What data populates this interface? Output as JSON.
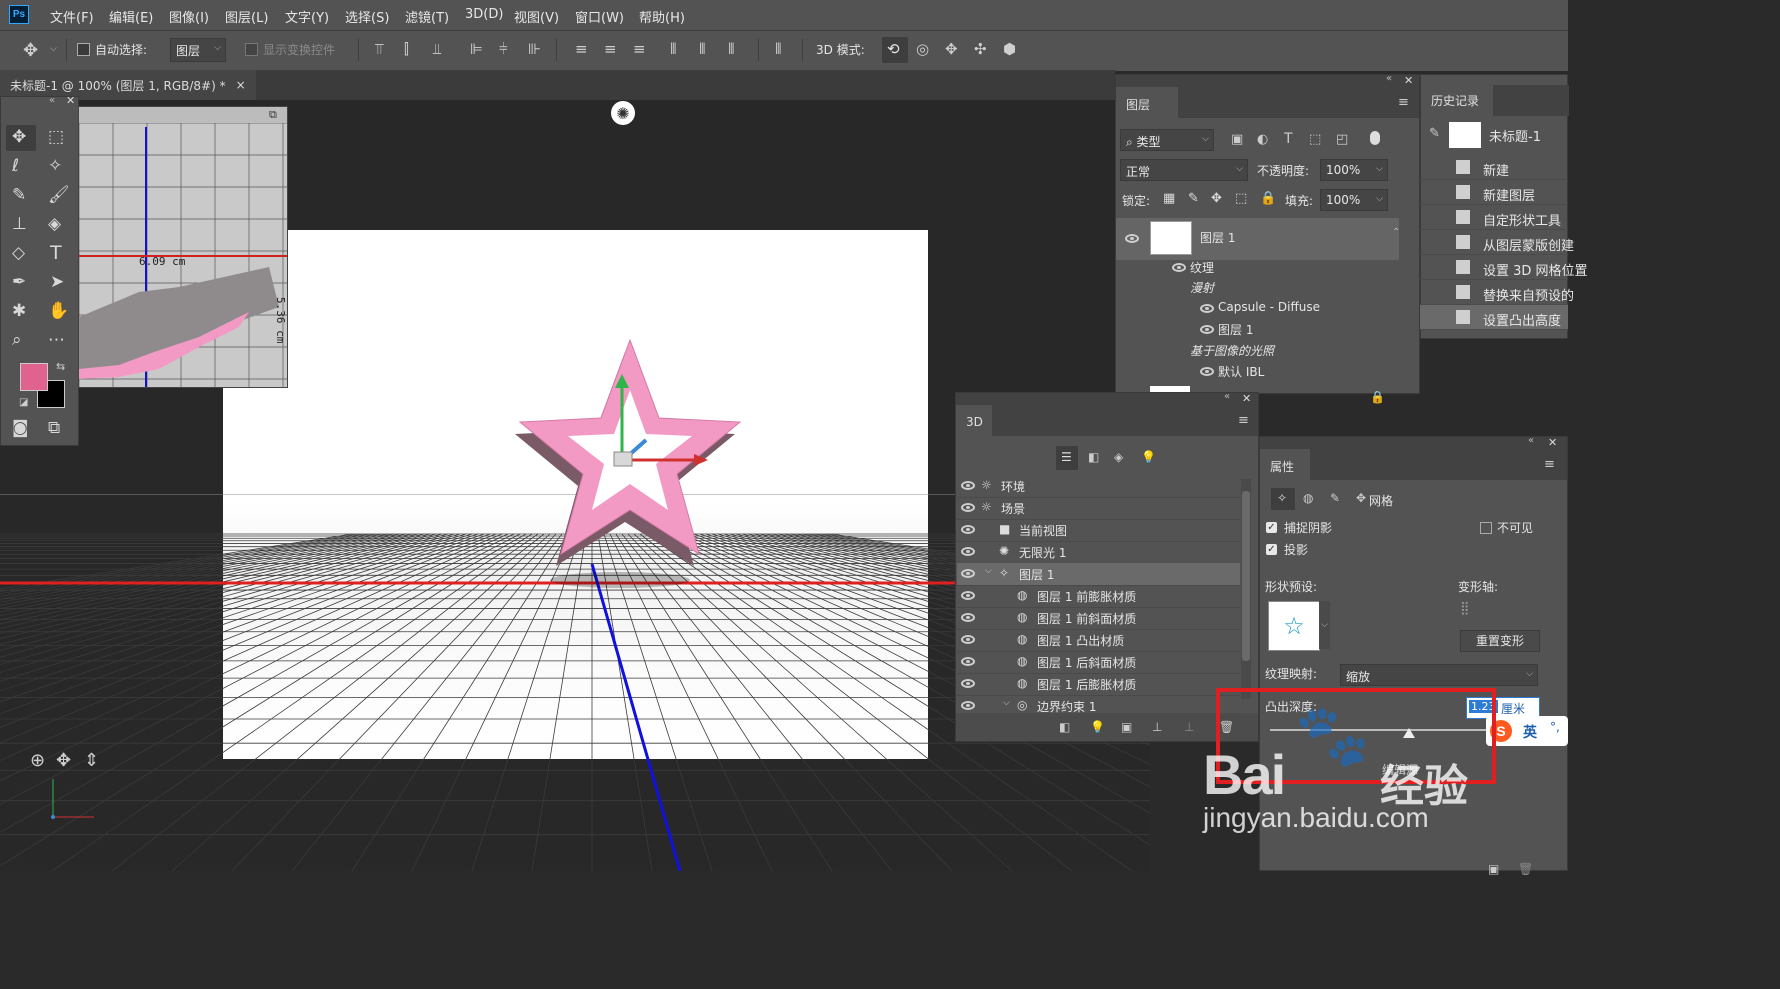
{
  "menubar": {
    "logo": "Ps",
    "items": [
      "文件(F)",
      "编辑(E)",
      "图像(I)",
      "图层(L)",
      "文字(Y)",
      "选择(S)",
      "滤镜(T)",
      "3D(D)",
      "视图(V)",
      "窗口(W)",
      "帮助(H)"
    ]
  },
  "options": {
    "auto_select_label": "自动选择:",
    "auto_select_value": "图层",
    "show_transform_label": "显示变换控件",
    "mode_3d_label": "3D 模式:"
  },
  "document": {
    "tab_title": "未标题-1 @ 100% (图层 1, RGB/8#) *",
    "close": "×"
  },
  "mini_view": {
    "measure_horizontal": "6.09 cm",
    "measure_vertical": "5.36 cm"
  },
  "layers_panel": {
    "tab": "图层",
    "filter_label": "类型",
    "blend_mode": "正常",
    "opacity_label": "不透明度:",
    "opacity_value": "100%",
    "lock_label": "锁定:",
    "fill_label": "填充:",
    "fill_value": "100%",
    "layer_name": "图层 1",
    "texture_label": "纹理",
    "diffuse_label": "漫射",
    "capsule_label": "Capsule - Diffuse",
    "sub_layer_label": "图层 1",
    "ibl_group_label": "基于图像的光照",
    "ibl_default_label": "默认 IBL"
  },
  "history_panel": {
    "tab": "历史记录",
    "snapshot_label": "未标题-1",
    "items": [
      "新建",
      "新建图层",
      "自定形状工具",
      "从图层蒙版创建",
      "设置 3D 网格位置",
      "替换来自预设的",
      "设置凸出高度"
    ]
  },
  "panel_3d": {
    "tab": "3D",
    "items": [
      {
        "label": "环境",
        "indent": 0
      },
      {
        "label": "场景",
        "indent": 0
      },
      {
        "label": "当前视图",
        "indent": 1
      },
      {
        "label": "无限光 1",
        "indent": 1
      },
      {
        "label": "图层 1",
        "indent": 1
      },
      {
        "label": "图层 1 前膨胀材质",
        "indent": 2
      },
      {
        "label": "图层 1 前斜面材质",
        "indent": 2
      },
      {
        "label": "图层 1 凸出材质",
        "indent": 2
      },
      {
        "label": "图层 1 后斜面材质",
        "indent": 2
      },
      {
        "label": "图层 1 后膨胀材质",
        "indent": 2
      },
      {
        "label": "边界约束 1",
        "indent": 2
      }
    ]
  },
  "properties_panel": {
    "tab": "属性",
    "mesh_label": "网格",
    "catch_shadow": "捕捉阴影",
    "invisible": "不可见",
    "cast_shadow": "投影",
    "shape_preset_label": "形状预设:",
    "deform_axis_label": "变形轴:",
    "reset_deform": "重置变形",
    "texture_mapping_label": "纹理映射:",
    "texture_mapping_value": "缩放",
    "extrusion_depth_label": "凸出深度:",
    "extrusion_depth_value": "1.23",
    "extrusion_depth_unit": "厘米",
    "edit_source": "编辑源",
    "ime_label": "英"
  },
  "watermark": {
    "brand": "Bai",
    "brand_cn": "经验",
    "url": "jingyan.baidu.com"
  },
  "colors": {
    "foreground": "#e0628f",
    "background": "#000000",
    "star_pink": "#f39ac4",
    "highlight_red": "#e02020"
  }
}
